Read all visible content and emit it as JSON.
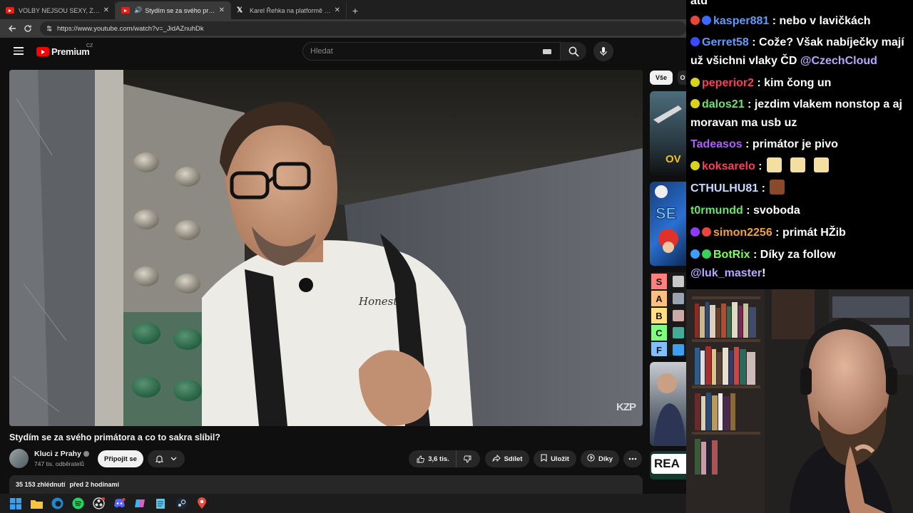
{
  "browser": {
    "tabs": [
      {
        "label": "VOLBY NEJSOU SEXY, Z NICH NEM",
        "type": "youtube",
        "active": false
      },
      {
        "label": "Stydím se za svého primátora",
        "type": "youtube",
        "active": true
      },
      {
        "label": "Karel Řehka na platformě X: „Po vř",
        "type": "x",
        "active": false
      }
    ],
    "close_glyph": "✕",
    "newtab_glyph": "+",
    "url": "https://www.youtube.com/watch?v=_JidAZnuhDk"
  },
  "youtube": {
    "logo_text": "Premium",
    "region": "CZ",
    "search_placeholder": "Hledat",
    "video": {
      "title": "Stydím se za svého primátora a co to sakra slíbil?",
      "watermark": "KZP",
      "shirt_text": "Honest"
    },
    "channel": {
      "name": "Kluci z Prahy",
      "subscribers": "747 tis. odběratelů",
      "join_label": "Připojit se"
    },
    "actions": {
      "likes": "3,6 tis.",
      "share": "Sdílet",
      "save": "Uložit",
      "thanks": "Díky"
    },
    "description": {
      "views": "35 153 zhlédnutí",
      "time": "před 2 hodinami"
    },
    "chips": {
      "all": "Vše",
      "next": "O"
    },
    "tier_letters": [
      "S",
      "A",
      "B",
      "C",
      "F"
    ],
    "rail_thumb_text": [
      "OV",
      "SE",
      "REA"
    ]
  },
  "chat": {
    "partial_top": "atd",
    "messages": [
      {
        "user": "kasper881",
        "color": "#5b9cff",
        "text": ": nebo v lavičkách",
        "badges": [
          "#e8453c",
          "#3a6bff"
        ]
      },
      {
        "user": "Gerret58",
        "color": "#5b9cff",
        "text": ": Cože? Však nabíječky mají už všichni vlaky ČD ",
        "mention": "@CzechCloud",
        "badges": [
          "#3a4bff"
        ]
      },
      {
        "user": "peperior2",
        "color": "#ff3c5a",
        "text": ": kim čong un",
        "badges": [
          "#d9d21a"
        ]
      },
      {
        "user": "dalos21",
        "color": "#6be36b",
        "text": ": jezdim vlakem nonstop a aj moravan ma usb uz",
        "badges": [
          "#d9d21a"
        ]
      },
      {
        "user": "Tadeasos",
        "color": "#b05cff",
        "text": ": primátor je pivo",
        "badges": []
      },
      {
        "user": "koksarelo",
        "color": "#ff3c5a",
        "text": ":",
        "badges": [
          "#d9d21a"
        ],
        "emotes": 3
      },
      {
        "user": "CTHULHU81",
        "color": "#c9d8ff",
        "text": ":",
        "badges": [],
        "emotes": 1
      },
      {
        "user": "t0rmundd",
        "color": "#6be36b",
        "text": ": svoboda",
        "badges": []
      },
      {
        "user": "simon2256",
        "color": "#f0a23a",
        "text": ": primát HŽib",
        "badges": [
          "#8a3cff",
          "#e8453c"
        ]
      },
      {
        "user": "BotRix",
        "color": "#7cff5a",
        "text": ": Díky za follow ",
        "mention": "@luk_master",
        "tail": "!",
        "badges": [
          "#3aa0ff",
          "#39d15b"
        ]
      }
    ]
  },
  "colors": {
    "yt_red": "#ff0000",
    "mention": "#b9a6ff"
  }
}
